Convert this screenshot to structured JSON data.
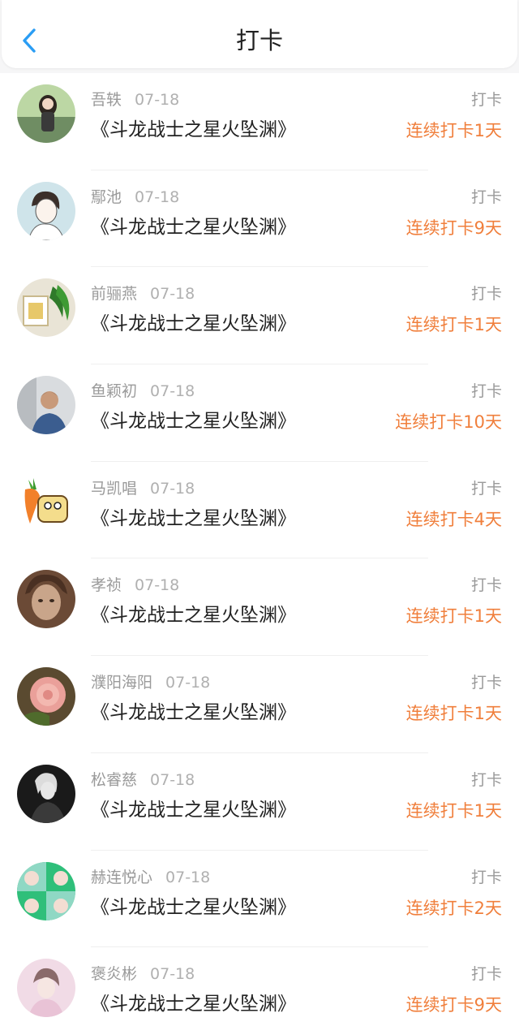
{
  "header": {
    "title": "打卡",
    "back_icon": "chevron-left-icon",
    "accent": "#2a9df4"
  },
  "colors": {
    "streak": "#f07f3c",
    "meta": "#9a9a9a"
  },
  "entries": [
    {
      "name": "吾轶",
      "date": "07-18",
      "book": "《斗龙战士之星火坠渊》",
      "action": "打卡",
      "streak": "连续打卡1天"
    },
    {
      "name": "鄢池",
      "date": "07-18",
      "book": "《斗龙战士之星火坠渊》",
      "action": "打卡",
      "streak": "连续打卡9天"
    },
    {
      "name": "前骊燕",
      "date": "07-18",
      "book": "《斗龙战士之星火坠渊》",
      "action": "打卡",
      "streak": "连续打卡1天"
    },
    {
      "name": "鱼颖初",
      "date": "07-18",
      "book": "《斗龙战士之星火坠渊》",
      "action": "打卡",
      "streak": "连续打卡10天"
    },
    {
      "name": "马凯唱",
      "date": "07-18",
      "book": "《斗龙战士之星火坠渊》",
      "action": "打卡",
      "streak": "连续打卡4天"
    },
    {
      "name": "孝祯",
      "date": "07-18",
      "book": "《斗龙战士之星火坠渊》",
      "action": "打卡",
      "streak": "连续打卡1天"
    },
    {
      "name": "濮阳海阳",
      "date": "07-18",
      "book": "《斗龙战士之星火坠渊》",
      "action": "打卡",
      "streak": "连续打卡1天"
    },
    {
      "name": "松睿慈",
      "date": "07-18",
      "book": "《斗龙战士之星火坠渊》",
      "action": "打卡",
      "streak": "连续打卡1天"
    },
    {
      "name": "赫连悦心",
      "date": "07-18",
      "book": "《斗龙战士之星火坠渊》",
      "action": "打卡",
      "streak": "连续打卡2天"
    },
    {
      "name": "褒炎彬",
      "date": "07-18",
      "book": "《斗龙战士之星火坠渊》",
      "action": "打卡",
      "streak": "连续打卡9天"
    }
  ]
}
